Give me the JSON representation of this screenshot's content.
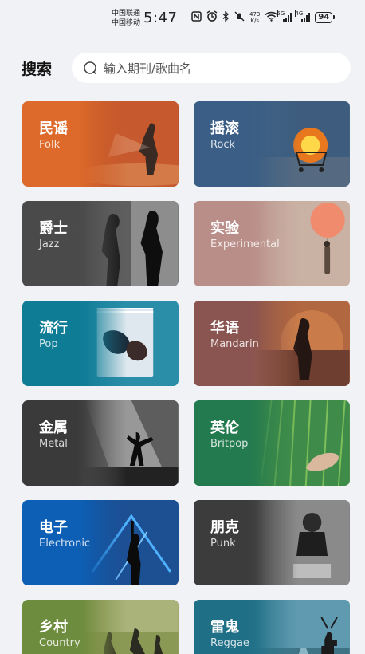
{
  "status": {
    "carrier_1": "中国联通",
    "carrier_2": "中国移动",
    "time": "5:47",
    "net_speed_value": "473",
    "net_speed_unit": "K/s",
    "sim1_tag": "5G",
    "sim2_tag": "4G",
    "battery": "94",
    "icons": [
      "nfc-icon",
      "alarm-icon",
      "bluetooth-icon",
      "mute-icon",
      "wifi-icon",
      "signal-icon",
      "battery-icon"
    ]
  },
  "search": {
    "title": "搜索",
    "placeholder": "输入期刊/歌曲名"
  },
  "genres": [
    {
      "name": "民谣",
      "en": "Folk",
      "color_left": "#dd6a2b",
      "color_right": "#b0452a",
      "art": "desert-figure"
    },
    {
      "name": "摇滚",
      "en": "Rock",
      "color_left": "#3a5e85",
      "color_right": "#4c6b88",
      "art": "burning-cart"
    },
    {
      "name": "爵士",
      "en": "Jazz",
      "color_left": "#4a4a4a",
      "color_right": "#6e6e6e",
      "art": "bw-figures"
    },
    {
      "name": "实验",
      "en": "Experimental",
      "color_left": "#b98e89",
      "color_right": "#cdb3a6",
      "art": "balloon"
    },
    {
      "name": "流行",
      "en": "Pop",
      "color_left": "#0f7c96",
      "color_right": "#2a8aa6",
      "art": "bed"
    },
    {
      "name": "华语",
      "en": "Mandarin",
      "color_left": "#8a5450",
      "color_right": "#b36b44",
      "art": "sunset-silhouette"
    },
    {
      "name": "金属",
      "en": "Metal",
      "color_left": "#3a3a3a",
      "color_right": "#8e8e8e",
      "art": "stage-light"
    },
    {
      "name": "英伦",
      "en": "Britpop",
      "color_left": "#237a4f",
      "color_right": "#5a9a45",
      "art": "grass-hand"
    },
    {
      "name": "电子",
      "en": "Electronic",
      "color_left": "#0d5fb5",
      "color_right": "#1a4f8e",
      "art": "neon-stage"
    },
    {
      "name": "朋克",
      "en": "Punk",
      "color_left": "#3c3c3c",
      "color_right": "#777777",
      "art": "drummer"
    },
    {
      "name": "乡村",
      "en": "Country",
      "color_left": "#6d8c3d",
      "color_right": "#a89a5a",
      "art": "field-runners"
    },
    {
      "name": "雷鬼",
      "en": "Reggae",
      "color_left": "#1f6f86",
      "color_right": "#5b97a8",
      "art": "deer-road"
    }
  ]
}
